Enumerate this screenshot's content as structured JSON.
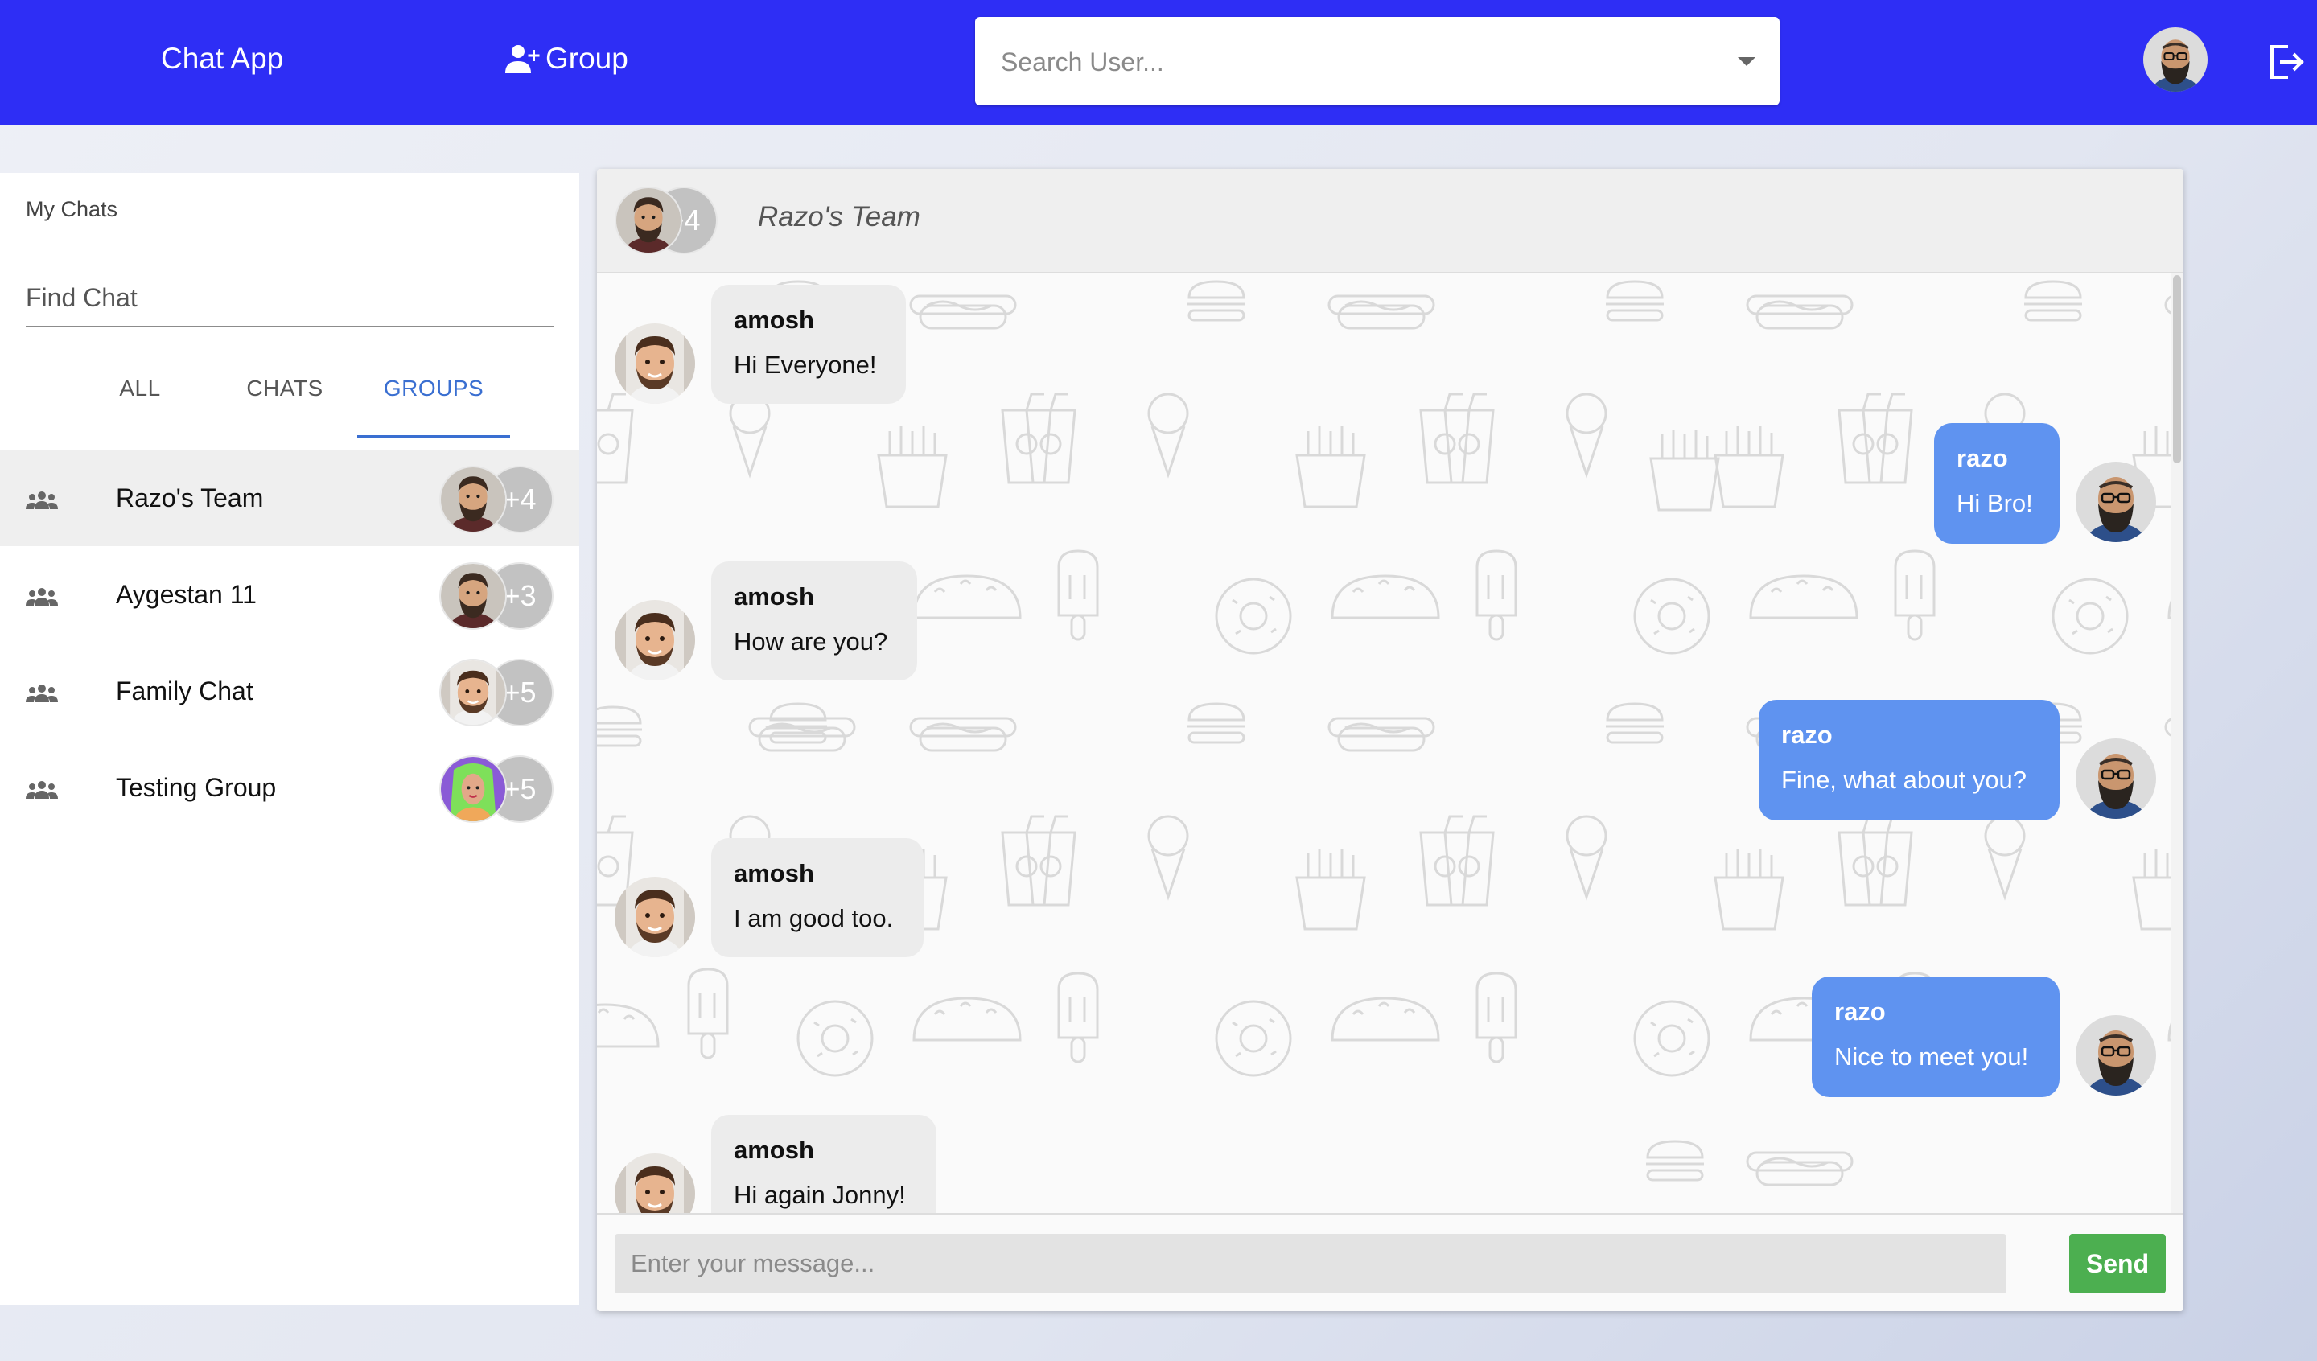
{
  "colors": {
    "topbar": "#2e2ef5",
    "accent": "#3a6fd1",
    "outgoing_bubble": "#5f93f0",
    "incoming_bubble": "#ececec",
    "send_button": "#4caf50"
  },
  "header": {
    "brand": "Chat App",
    "group_button_label": "Group",
    "group_button_icon": "add-user-icon",
    "search_placeholder": "Search User...",
    "logout_icon": "logout-icon"
  },
  "sidebar": {
    "title": "My Chats",
    "find_placeholder": "Find Chat",
    "tabs": [
      {
        "label": "ALL",
        "active": false
      },
      {
        "label": "CHATS",
        "active": false
      },
      {
        "label": "GROUPS",
        "active": true
      }
    ],
    "items": [
      {
        "name": "Razo's Team",
        "count": "+4",
        "selected": true,
        "avatar": "bearded"
      },
      {
        "name": "Aygestan 11",
        "count": "+3",
        "selected": false,
        "avatar": "bearded"
      },
      {
        "name": "Family Chat",
        "count": "+5",
        "selected": false,
        "avatar": "amosh"
      },
      {
        "name": "Testing Group",
        "count": "+5",
        "selected": false,
        "avatar": "green-hair"
      }
    ]
  },
  "chat": {
    "title": "Razo's Team",
    "member_count": "+4",
    "messages": [
      {
        "sender": "amosh",
        "text": "Hi Everyone!",
        "direction": "in"
      },
      {
        "sender": "razo",
        "text": "Hi Bro!",
        "direction": "out"
      },
      {
        "sender": "amosh",
        "text": "How are you?",
        "direction": "in"
      },
      {
        "sender": "razo",
        "text": "Fine, what about you?",
        "direction": "out"
      },
      {
        "sender": "amosh",
        "text": "I am good too.",
        "direction": "in"
      },
      {
        "sender": "razo",
        "text": "Nice to meet you!",
        "direction": "out"
      },
      {
        "sender": "amosh",
        "text": "Hi again Jonny!",
        "direction": "in"
      }
    ],
    "input_placeholder": "Enter your message...",
    "send_label": "Send"
  }
}
